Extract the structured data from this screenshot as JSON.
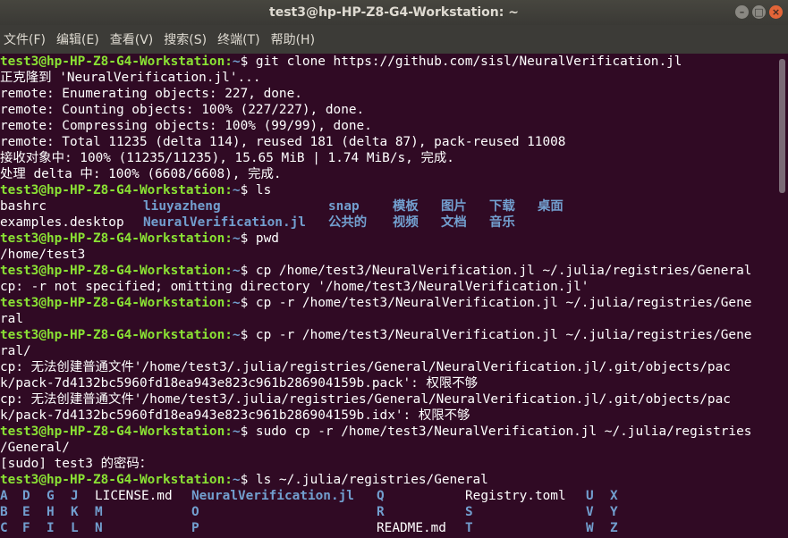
{
  "window": {
    "title": "test3@hp-HP-Z8-G4-Workstation: ~",
    "buttons": [
      "–",
      "□",
      "×"
    ]
  },
  "menu": [
    "文件(F)",
    "编辑(E)",
    "查看(V)",
    "搜索(S)",
    "终端(T)",
    "帮助(H)"
  ],
  "prompt": {
    "user": "test3@hp-HP-Z8-G4-Workstation",
    "path": "~",
    "sym": "$ "
  },
  "lines": [
    {
      "type": "cmd",
      "text": "git clone https://github.com/sisl/NeuralVerification.jl"
    },
    {
      "type": "out",
      "text": "正克隆到 'NeuralVerification.jl'..."
    },
    {
      "type": "out",
      "text": "remote: Enumerating objects: 227, done."
    },
    {
      "type": "out",
      "text": "remote: Counting objects: 100% (227/227), done."
    },
    {
      "type": "out",
      "text": "remote: Compressing objects: 100% (99/99), done."
    },
    {
      "type": "out",
      "text": "remote: Total 11235 (delta 114), reused 181 (delta 87), pack-reused 11008"
    },
    {
      "type": "out",
      "text": "接收对象中: 100% (11235/11235), 15.65 MiB | 1.74 MiB/s, 完成."
    },
    {
      "type": "out",
      "text": "处理 delta 中: 100% (6608/6608), 完成."
    },
    {
      "type": "cmd",
      "text": "ls"
    },
    {
      "type": "ls",
      "cells": [
        {
          "col": 0,
          "text": "bashrc",
          "kind": "file"
        },
        {
          "col": 160,
          "text": "liuyazheng",
          "kind": "dir"
        },
        {
          "col": 367,
          "text": "snap",
          "kind": "dir"
        },
        {
          "col": 439,
          "text": "模板",
          "kind": "dir"
        },
        {
          "col": 493,
          "text": "图片",
          "kind": "dir"
        },
        {
          "col": 547,
          "text": "下载",
          "kind": "dir"
        },
        {
          "col": 601,
          "text": "桌面",
          "kind": "dir"
        }
      ]
    },
    {
      "type": "ls",
      "cells": [
        {
          "col": 0,
          "text": "examples.desktop",
          "kind": "file"
        },
        {
          "col": 160,
          "text": "NeuralVerification.jl",
          "kind": "dir"
        },
        {
          "col": 367,
          "text": "公共的",
          "kind": "dir"
        },
        {
          "col": 439,
          "text": "视频",
          "kind": "dir"
        },
        {
          "col": 493,
          "text": "文档",
          "kind": "dir"
        },
        {
          "col": 547,
          "text": "音乐",
          "kind": "dir"
        }
      ]
    },
    {
      "type": "cmd",
      "text": "pwd"
    },
    {
      "type": "out",
      "text": "/home/test3"
    },
    {
      "type": "cmd",
      "text": "cp /home/test3/NeuralVerification.jl ~/.julia/registries/General"
    },
    {
      "type": "out",
      "text": "cp: -r not specified; omitting directory '/home/test3/NeuralVerification.jl'"
    },
    {
      "type": "cmd",
      "text": "cp -r /home/test3/NeuralVerification.jl ~/.julia/registries/Gene"
    },
    {
      "type": "out",
      "text": "ral"
    },
    {
      "type": "cmd",
      "text": "cp -r /home/test3/NeuralVerification.jl ~/.julia/registries/Gene"
    },
    {
      "type": "out",
      "text": "ral/"
    },
    {
      "type": "out",
      "text": "cp: 无法创建普通文件'/home/test3/.julia/registries/General/NeuralVerification.jl/.git/objects/pac"
    },
    {
      "type": "out",
      "text": "k/pack-7d4132bc5960fd18ea943e823c961b286904159b.pack': 权限不够"
    },
    {
      "type": "out",
      "text": "cp: 无法创建普通文件'/home/test3/.julia/registries/General/NeuralVerification.jl/.git/objects/pac"
    },
    {
      "type": "out",
      "text": "k/pack-7d4132bc5960fd18ea943e823c961b286904159b.idx': 权限不够"
    },
    {
      "type": "cmd",
      "text": "sudo cp -r /home/test3/NeuralVerification.jl ~/.julia/registries"
    },
    {
      "type": "out",
      "text": "/General/"
    },
    {
      "type": "out",
      "text": "[sudo] test3 的密码："
    },
    {
      "type": "cmd",
      "text": "ls ~/.julia/registries/General"
    },
    {
      "type": "ls",
      "cells": [
        {
          "col": 0,
          "text": "A",
          "kind": "dir"
        },
        {
          "col": 25,
          "text": "D",
          "kind": "dir"
        },
        {
          "col": 52,
          "text": "G",
          "kind": "dir"
        },
        {
          "col": 79,
          "text": "J",
          "kind": "dir"
        },
        {
          "col": 106,
          "text": "LICENSE.md",
          "kind": "file"
        },
        {
          "col": 214,
          "text": "NeuralVerification.jl",
          "kind": "dir"
        },
        {
          "col": 421,
          "text": "Q",
          "kind": "dir"
        },
        {
          "col": 520,
          "text": "Registry.toml",
          "kind": "file"
        },
        {
          "col": 655,
          "text": "U",
          "kind": "dir"
        },
        {
          "col": 682,
          "text": "X",
          "kind": "dir"
        }
      ]
    },
    {
      "type": "ls",
      "cells": [
        {
          "col": 0,
          "text": "B",
          "kind": "dir"
        },
        {
          "col": 25,
          "text": "E",
          "kind": "dir"
        },
        {
          "col": 52,
          "text": "H",
          "kind": "dir"
        },
        {
          "col": 79,
          "text": "K",
          "kind": "dir"
        },
        {
          "col": 106,
          "text": "M",
          "kind": "dir"
        },
        {
          "col": 214,
          "text": "O",
          "kind": "dir"
        },
        {
          "col": 421,
          "text": "R",
          "kind": "dir"
        },
        {
          "col": 520,
          "text": "S",
          "kind": "dir"
        },
        {
          "col": 655,
          "text": "V",
          "kind": "dir"
        },
        {
          "col": 682,
          "text": "Y",
          "kind": "dir"
        }
      ]
    },
    {
      "type": "ls",
      "cells": [
        {
          "col": 0,
          "text": "C",
          "kind": "dir"
        },
        {
          "col": 25,
          "text": "F",
          "kind": "dir"
        },
        {
          "col": 52,
          "text": "I",
          "kind": "dir"
        },
        {
          "col": 79,
          "text": "L",
          "kind": "dir"
        },
        {
          "col": 106,
          "text": "N",
          "kind": "dir"
        },
        {
          "col": 214,
          "text": "P",
          "kind": "dir"
        },
        {
          "col": 421,
          "text": "README.md",
          "kind": "file"
        },
        {
          "col": 520,
          "text": "T",
          "kind": "dir"
        },
        {
          "col": 655,
          "text": "W",
          "kind": "dir"
        },
        {
          "col": 682,
          "text": "Z",
          "kind": "dir"
        }
      ]
    }
  ]
}
